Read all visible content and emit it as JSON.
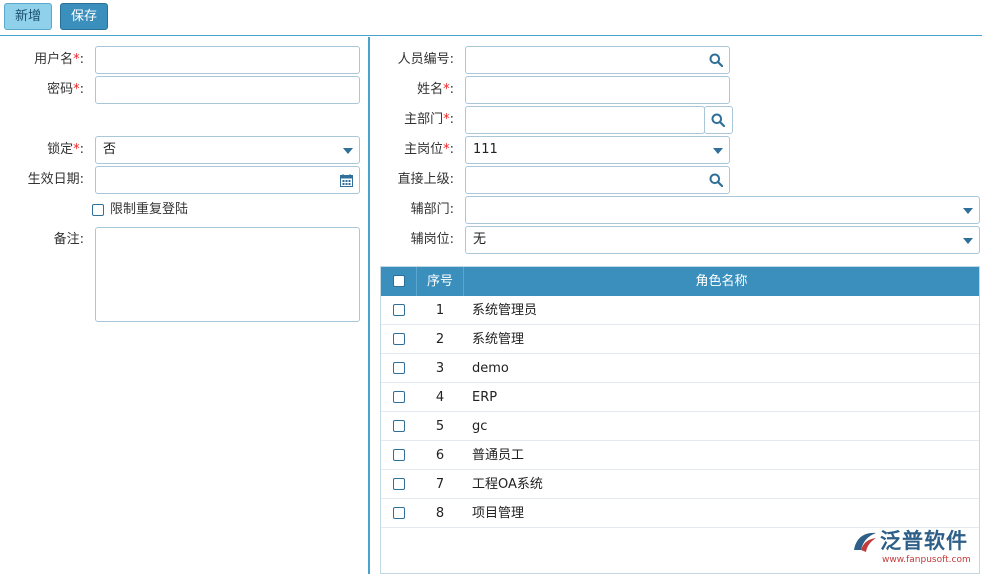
{
  "toolbar": {
    "new_label": "新增",
    "save_label": "保存"
  },
  "left_form": {
    "username": {
      "label": "用户名",
      "value": ""
    },
    "password": {
      "label": "密码",
      "value": ""
    },
    "locked": {
      "label": "锁定",
      "value": "否"
    },
    "effective_date": {
      "label": "生效日期",
      "value": ""
    },
    "limit_login": {
      "label": "限制重复登陆"
    },
    "remark": {
      "label": "备注"
    }
  },
  "right_form": {
    "staff_no": {
      "label": "人员编号",
      "value": ""
    },
    "name": {
      "label": "姓名",
      "value": ""
    },
    "main_dept": {
      "label": "主部门",
      "value": ""
    },
    "main_post": {
      "label": "主岗位",
      "value": "111"
    },
    "superior": {
      "label": "直接上级",
      "value": ""
    },
    "sub_dept": {
      "label": "辅部门",
      "value": ""
    },
    "sub_post": {
      "label": "辅岗位",
      "value": "无"
    }
  },
  "required_mark": "*",
  "colon": ":",
  "grid": {
    "columns": {
      "seq": "序号",
      "role": "角色名称"
    },
    "rows": [
      {
        "seq": "1",
        "role": "系统管理员"
      },
      {
        "seq": "2",
        "role": "系统管理"
      },
      {
        "seq": "3",
        "role": "demo"
      },
      {
        "seq": "4",
        "role": "ERP"
      },
      {
        "seq": "5",
        "role": "gc"
      },
      {
        "seq": "6",
        "role": "普通员工"
      },
      {
        "seq": "7",
        "role": "工程OA系统"
      },
      {
        "seq": "8",
        "role": "项目管理"
      }
    ]
  },
  "logo": {
    "text": "泛普软件",
    "url": "www.fanpusoft.com"
  },
  "colors": {
    "accent": "#3a8fbd",
    "border": "#a9c7d9",
    "required": "#e22222"
  }
}
